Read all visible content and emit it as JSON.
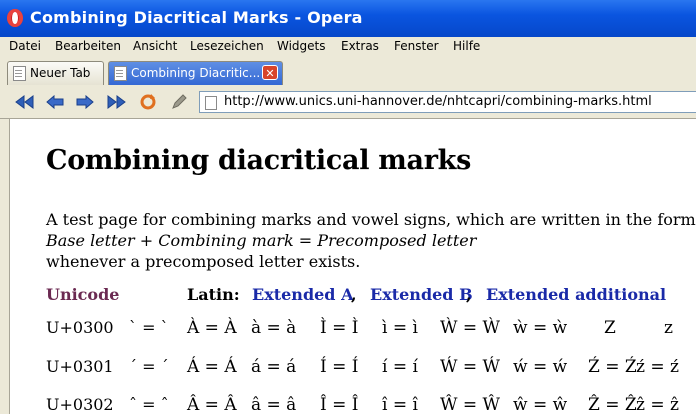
{
  "window": {
    "title": "Combining Diacritical Marks - Opera"
  },
  "menu": {
    "items": [
      "Datei",
      "Bearbeiten",
      "Ansicht",
      "Lesezeichen",
      "Widgets",
      "Extras",
      "Fenster",
      "Hilfe"
    ]
  },
  "tabs": [
    {
      "label": "Neuer Tab"
    },
    {
      "label": "Combining Diacritic..."
    }
  ],
  "address": {
    "url": "http://www.unics.uni-hannover.de/nhtcapri/combining-marks.html"
  },
  "page": {
    "heading": "Combining diacritical marks",
    "intro_line1": "A test page for combining marks and vowel signs, which are written in the form",
    "intro_formula": "Base letter + Combining mark = Precomposed letter",
    "intro_line3": "whenever a precomposed letter exists.",
    "headers": {
      "unicode": "Unicode",
      "latin": "Latin:",
      "ext_a": "Extended A",
      "ext_b": "Extended B",
      "ext_add": "Extended additional",
      "sep": ","
    },
    "rows": [
      {
        "code": "U+0300",
        "mark": "` = `",
        "a": "À = À",
        "a2": "à = à",
        "i": "Ì = Ì",
        "i2": "ì = ì",
        "w": "Ẁ = Ẁ",
        "w2": "ẁ = ẁ",
        "z": "Z",
        "z2": "z"
      },
      {
        "code": "U+0301",
        "mark": "´ = ´",
        "a": "Á = Á",
        "a2": "á = á",
        "i": "Í = Í",
        "i2": "í = í",
        "w": "Ẃ = Ẃ",
        "w2": "ẃ = ẃ",
        "z": "Ź = Ź",
        "z2": "ź = ź"
      },
      {
        "code": "U+0302",
        "mark": "ˆ = ˆ",
        "a": "Â = Â",
        "a2": "â = â",
        "i": "Î = Î",
        "i2": "î = î",
        "w": "Ŵ = Ŵ",
        "w2": "ŵ = ŵ",
        "z": "Ẑ = Ẑ",
        "z2": "ẑ = ẑ"
      }
    ]
  }
}
